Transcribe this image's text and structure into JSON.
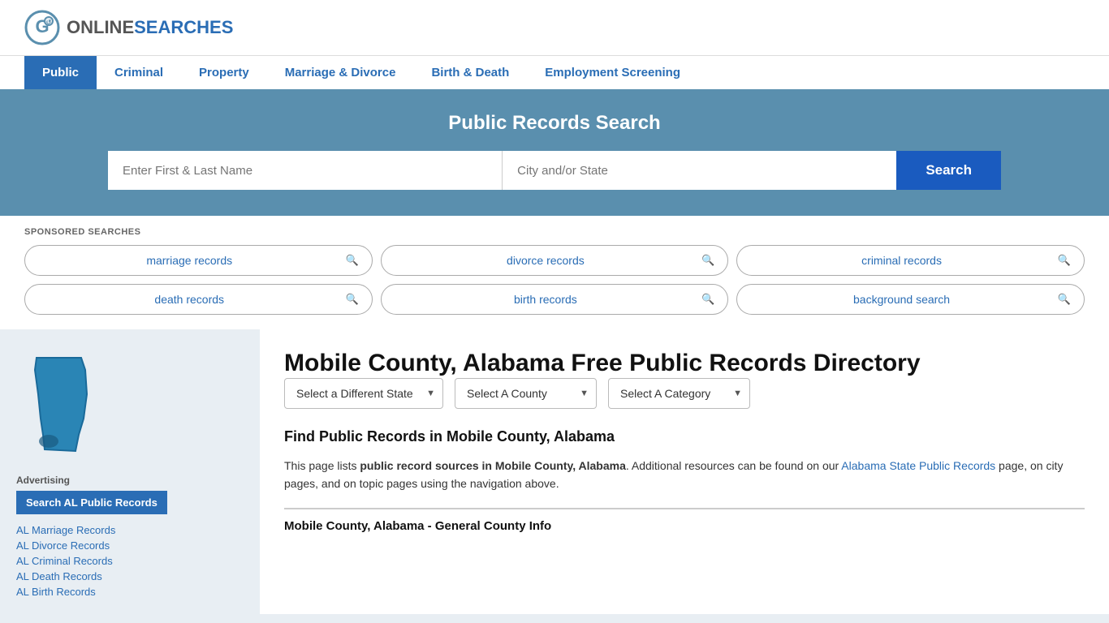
{
  "site": {
    "logo_text_online": "ONLINE",
    "logo_text_searches": "SEARCHES"
  },
  "nav": {
    "items": [
      {
        "label": "Public",
        "active": true
      },
      {
        "label": "Criminal",
        "active": false
      },
      {
        "label": "Property",
        "active": false
      },
      {
        "label": "Marriage & Divorce",
        "active": false
      },
      {
        "label": "Birth & Death",
        "active": false
      },
      {
        "label": "Employment Screening",
        "active": false
      }
    ]
  },
  "hero": {
    "title": "Public Records Search",
    "name_placeholder": "Enter First & Last Name",
    "location_placeholder": "City and/or State",
    "search_label": "Search"
  },
  "sponsored": {
    "label": "SPONSORED SEARCHES",
    "tags": [
      {
        "label": "marriage records"
      },
      {
        "label": "divorce records"
      },
      {
        "label": "criminal records"
      },
      {
        "label": "death records"
      },
      {
        "label": "birth records"
      },
      {
        "label": "background search"
      }
    ]
  },
  "directory": {
    "title": "Mobile County, Alabama Free Public Records Directory",
    "state_selector": "Select a Different State",
    "county_selector": "Select A County",
    "category_selector": "Select A Category",
    "find_title": "Find Public Records in Mobile County, Alabama",
    "description_part1": "This page lists ",
    "description_bold": "public record sources in Mobile County, Alabama",
    "description_part2": ". Additional resources can be found on our ",
    "description_link": "Alabama State Public Records",
    "description_part3": " page, on city pages, and on topic pages using the navigation above.",
    "county_info_header": "Mobile County, Alabama - General County Info"
  },
  "sidebar": {
    "advertising_label": "Advertising",
    "ad_button": "Search AL Public Records",
    "links": [
      {
        "label": "AL Marriage Records"
      },
      {
        "label": "AL Divorce Records"
      },
      {
        "label": "AL Criminal Records"
      },
      {
        "label": "AL Death Records"
      },
      {
        "label": "AL Birth Records"
      }
    ]
  }
}
